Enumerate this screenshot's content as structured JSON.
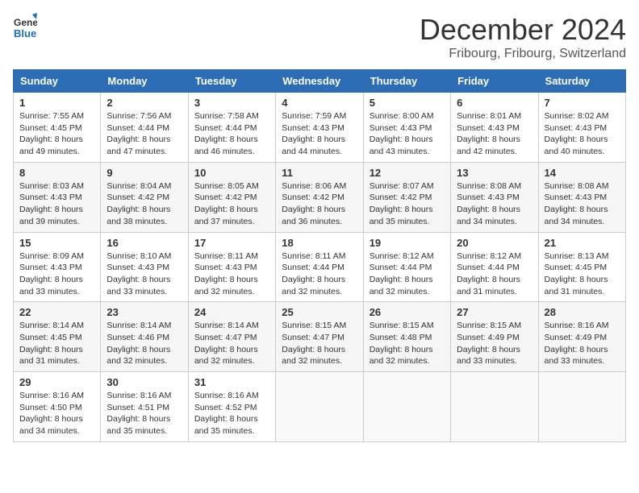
{
  "header": {
    "logo_line1": "General",
    "logo_line2": "Blue",
    "month": "December 2024",
    "location": "Fribourg, Fribourg, Switzerland"
  },
  "weekdays": [
    "Sunday",
    "Monday",
    "Tuesday",
    "Wednesday",
    "Thursday",
    "Friday",
    "Saturday"
  ],
  "weeks": [
    [
      {
        "day": "1",
        "sunrise": "7:55 AM",
        "sunset": "4:45 PM",
        "daylight": "8 hours and 49 minutes."
      },
      {
        "day": "2",
        "sunrise": "7:56 AM",
        "sunset": "4:44 PM",
        "daylight": "8 hours and 47 minutes."
      },
      {
        "day": "3",
        "sunrise": "7:58 AM",
        "sunset": "4:44 PM",
        "daylight": "8 hours and 46 minutes."
      },
      {
        "day": "4",
        "sunrise": "7:59 AM",
        "sunset": "4:43 PM",
        "daylight": "8 hours and 44 minutes."
      },
      {
        "day": "5",
        "sunrise": "8:00 AM",
        "sunset": "4:43 PM",
        "daylight": "8 hours and 43 minutes."
      },
      {
        "day": "6",
        "sunrise": "8:01 AM",
        "sunset": "4:43 PM",
        "daylight": "8 hours and 42 minutes."
      },
      {
        "day": "7",
        "sunrise": "8:02 AM",
        "sunset": "4:43 PM",
        "daylight": "8 hours and 40 minutes."
      }
    ],
    [
      {
        "day": "8",
        "sunrise": "8:03 AM",
        "sunset": "4:43 PM",
        "daylight": "8 hours and 39 minutes."
      },
      {
        "day": "9",
        "sunrise": "8:04 AM",
        "sunset": "4:42 PM",
        "daylight": "8 hours and 38 minutes."
      },
      {
        "day": "10",
        "sunrise": "8:05 AM",
        "sunset": "4:42 PM",
        "daylight": "8 hours and 37 minutes."
      },
      {
        "day": "11",
        "sunrise": "8:06 AM",
        "sunset": "4:42 PM",
        "daylight": "8 hours and 36 minutes."
      },
      {
        "day": "12",
        "sunrise": "8:07 AM",
        "sunset": "4:42 PM",
        "daylight": "8 hours and 35 minutes."
      },
      {
        "day": "13",
        "sunrise": "8:08 AM",
        "sunset": "4:43 PM",
        "daylight": "8 hours and 34 minutes."
      },
      {
        "day": "14",
        "sunrise": "8:08 AM",
        "sunset": "4:43 PM",
        "daylight": "8 hours and 34 minutes."
      }
    ],
    [
      {
        "day": "15",
        "sunrise": "8:09 AM",
        "sunset": "4:43 PM",
        "daylight": "8 hours and 33 minutes."
      },
      {
        "day": "16",
        "sunrise": "8:10 AM",
        "sunset": "4:43 PM",
        "daylight": "8 hours and 33 minutes."
      },
      {
        "day": "17",
        "sunrise": "8:11 AM",
        "sunset": "4:43 PM",
        "daylight": "8 hours and 32 minutes."
      },
      {
        "day": "18",
        "sunrise": "8:11 AM",
        "sunset": "4:44 PM",
        "daylight": "8 hours and 32 minutes."
      },
      {
        "day": "19",
        "sunrise": "8:12 AM",
        "sunset": "4:44 PM",
        "daylight": "8 hours and 32 minutes."
      },
      {
        "day": "20",
        "sunrise": "8:12 AM",
        "sunset": "4:44 PM",
        "daylight": "8 hours and 31 minutes."
      },
      {
        "day": "21",
        "sunrise": "8:13 AM",
        "sunset": "4:45 PM",
        "daylight": "8 hours and 31 minutes."
      }
    ],
    [
      {
        "day": "22",
        "sunrise": "8:14 AM",
        "sunset": "4:45 PM",
        "daylight": "8 hours and 31 minutes."
      },
      {
        "day": "23",
        "sunrise": "8:14 AM",
        "sunset": "4:46 PM",
        "daylight": "8 hours and 32 minutes."
      },
      {
        "day": "24",
        "sunrise": "8:14 AM",
        "sunset": "4:47 PM",
        "daylight": "8 hours and 32 minutes."
      },
      {
        "day": "25",
        "sunrise": "8:15 AM",
        "sunset": "4:47 PM",
        "daylight": "8 hours and 32 minutes."
      },
      {
        "day": "26",
        "sunrise": "8:15 AM",
        "sunset": "4:48 PM",
        "daylight": "8 hours and 32 minutes."
      },
      {
        "day": "27",
        "sunrise": "8:15 AM",
        "sunset": "4:49 PM",
        "daylight": "8 hours and 33 minutes."
      },
      {
        "day": "28",
        "sunrise": "8:16 AM",
        "sunset": "4:49 PM",
        "daylight": "8 hours and 33 minutes."
      }
    ],
    [
      {
        "day": "29",
        "sunrise": "8:16 AM",
        "sunset": "4:50 PM",
        "daylight": "8 hours and 34 minutes."
      },
      {
        "day": "30",
        "sunrise": "8:16 AM",
        "sunset": "4:51 PM",
        "daylight": "8 hours and 35 minutes."
      },
      {
        "day": "31",
        "sunrise": "8:16 AM",
        "sunset": "4:52 PM",
        "daylight": "8 hours and 35 minutes."
      },
      null,
      null,
      null,
      null
    ]
  ]
}
